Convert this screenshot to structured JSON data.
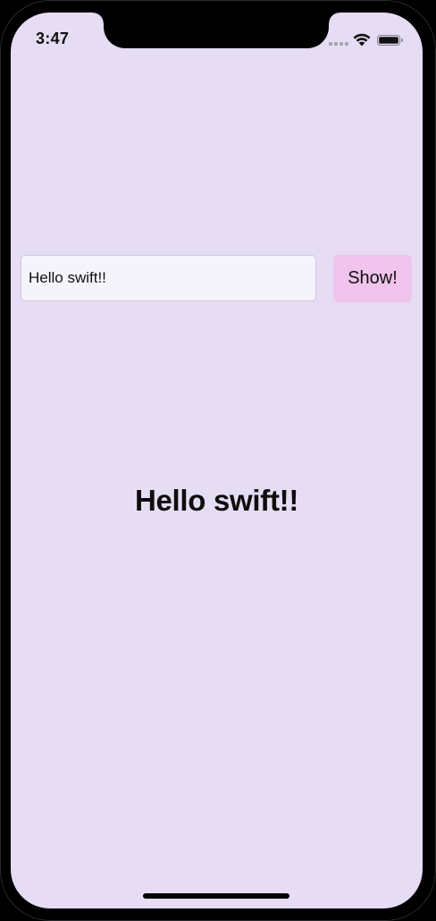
{
  "status_bar": {
    "time": "3:47",
    "signal_icon": "cellular-signal-icon",
    "wifi_icon": "wifi-icon",
    "battery_icon": "battery-icon"
  },
  "input": {
    "value": "Hello swift!!",
    "placeholder": ""
  },
  "show_button": {
    "label": "Show!"
  },
  "result": {
    "text": "Hello swift!!"
  },
  "colors": {
    "background": "#e6dcf4",
    "text_field_bg": "#f6f4fb",
    "button_bg": "#f0c4ec",
    "text": "#111111"
  }
}
